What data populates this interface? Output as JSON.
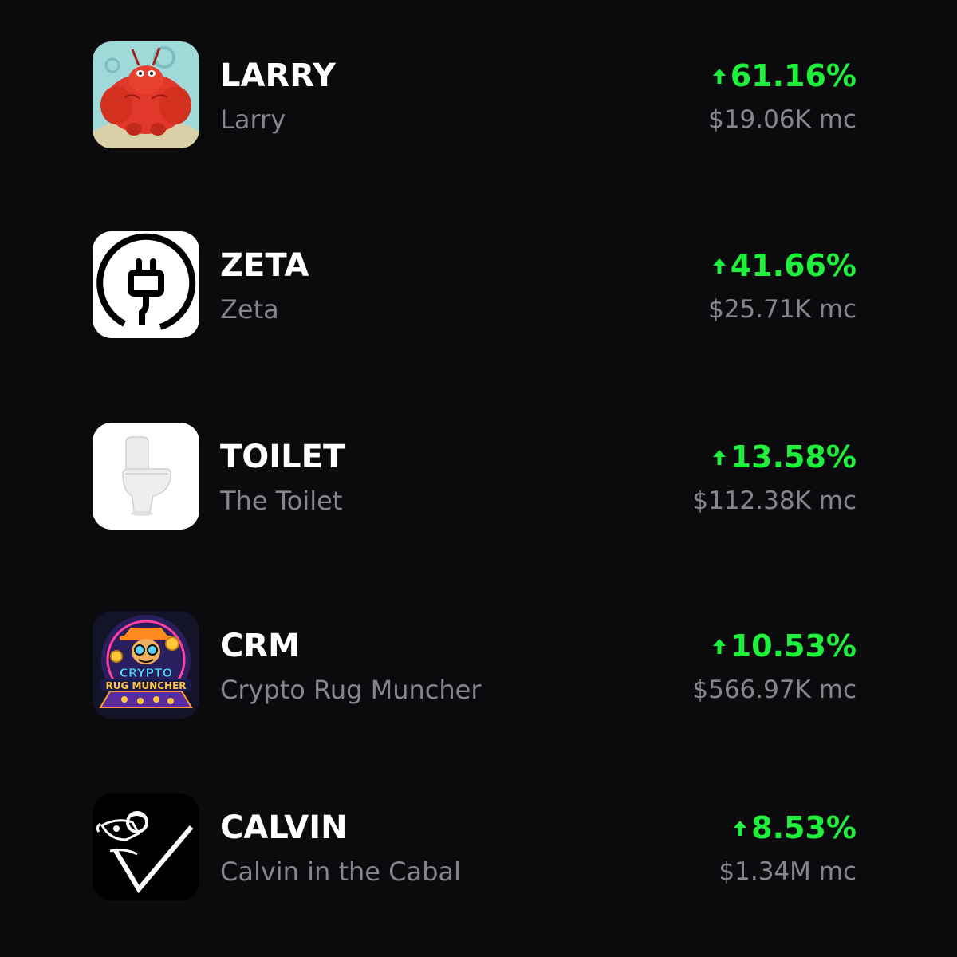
{
  "colors": {
    "background": "#0b0b0d",
    "symbol_text": "#ffffff",
    "secondary_text": "#84858e",
    "positive_change": "#1ff03c"
  },
  "tokens": [
    {
      "icon": "larry-lobster-icon",
      "symbol": "LARRY",
      "name": "Larry",
      "change": "61.16%",
      "market_cap": "$19.06K mc"
    },
    {
      "icon": "plug-icon",
      "symbol": "ZETA",
      "name": "Zeta",
      "change": "41.66%",
      "market_cap": "$25.71K mc"
    },
    {
      "icon": "toilet-icon",
      "symbol": "TOILET",
      "name": "The Toilet",
      "change": "13.58%",
      "market_cap": "$112.38K mc"
    },
    {
      "icon": "crypto-rug-muncher-icon",
      "icon_text": [
        "CRYPTO",
        "RUG MUNCHER"
      ],
      "symbol": "CRM",
      "name": "Crypto Rug Muncher",
      "change": "10.53%",
      "market_cap": "$566.97K mc"
    },
    {
      "icon": "calvin-cabal-icon",
      "symbol": "CALVIN",
      "name": "Calvin in the Cabal",
      "change": "8.53%",
      "market_cap": "$1.34M mc"
    }
  ]
}
